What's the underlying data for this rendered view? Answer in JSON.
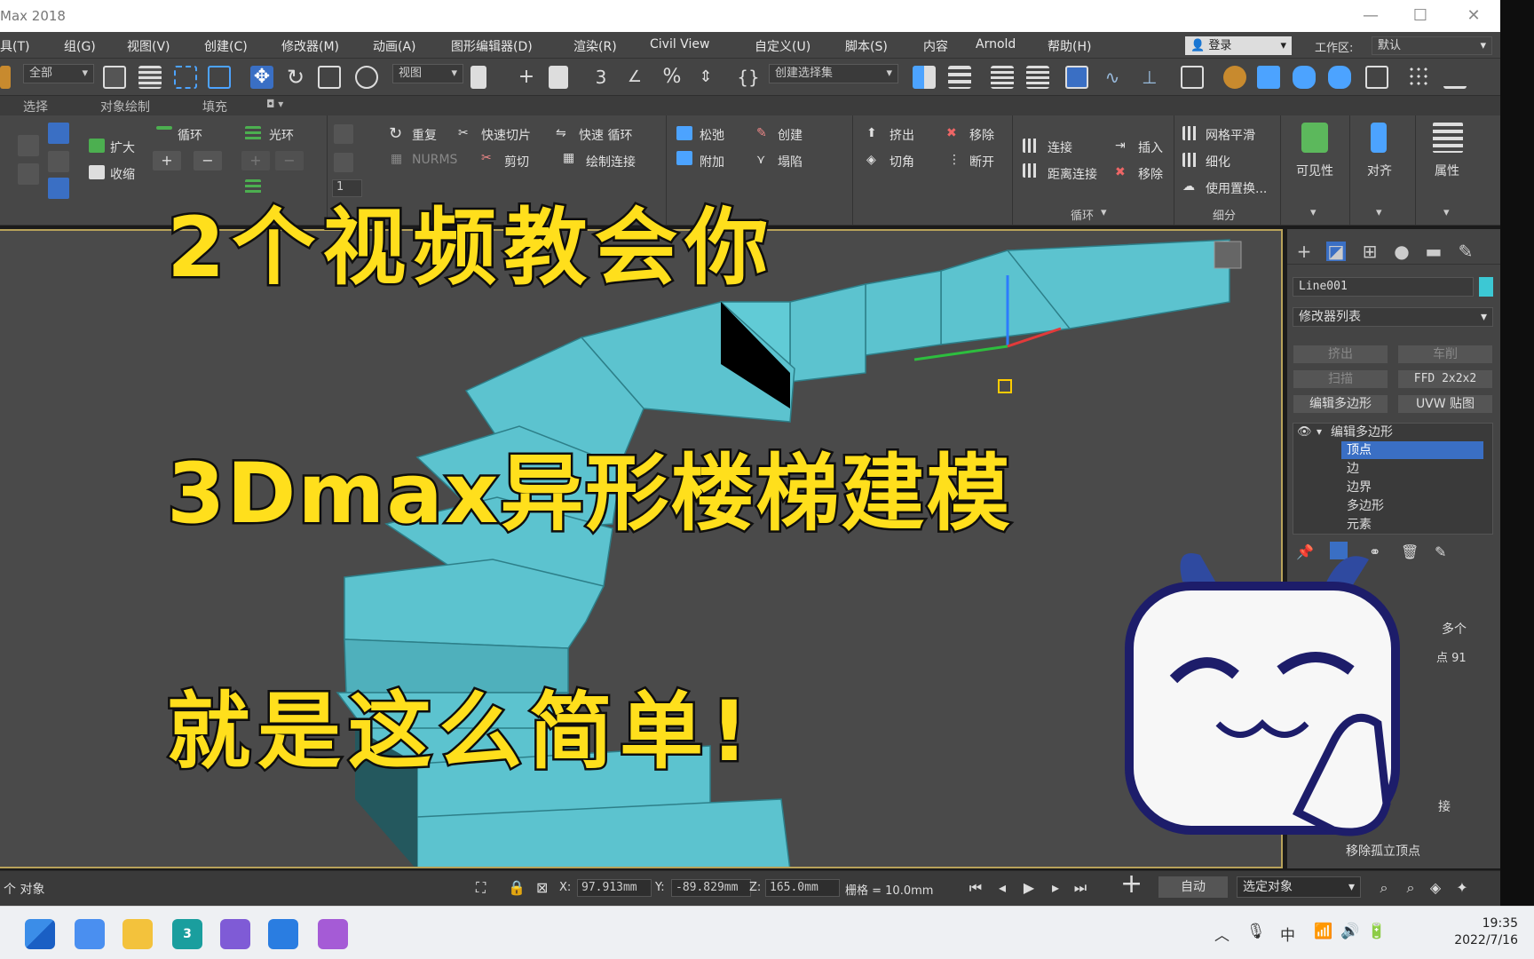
{
  "window": {
    "title": "Max 2018",
    "minimize": "—",
    "maximize": "☐",
    "close": "✕"
  },
  "menu": {
    "items": [
      "具(T)",
      "组(G)",
      "视图(V)",
      "创建(C)",
      "修改器(M)",
      "动画(A)",
      "图形编辑器(D)",
      "渲染(R)",
      "Civil View",
      "自定义(U)",
      "脚本(S)",
      "内容",
      "Arnold",
      "帮助(H)"
    ],
    "login": "登录",
    "workspace_label": "工作区:",
    "workspace_value": "默认"
  },
  "toolbar": {
    "filter": "全部",
    "coord_system": "视图",
    "selection_set": "创建选择集"
  },
  "ribbon_tabs": {
    "select": "选择",
    "object_paint": "对象绘制",
    "fill": "填充"
  },
  "ribbon": {
    "grow": "扩大",
    "shrink": "收缩",
    "loop": "循环",
    "ring": "光环",
    "repeat": "重复",
    "nurms": "NURMS",
    "quickslice": "快速切片",
    "cut": "剪切",
    "swiftloop": "快速 循环",
    "paintconnect": "绘制连接",
    "relax": "松弛",
    "attach": "附加",
    "create": "创建",
    "collapse": "塌陷",
    "extrude": "挤出",
    "chamfer": "切角",
    "remove": "移除",
    "break": "断开",
    "connect": "连接",
    "distconnect": "距离连接",
    "insert": "插入",
    "remove2": "移除",
    "meshsmooth": "网格平滑",
    "tessellate": "细化",
    "usedisplace": "使用置换...",
    "loop_group": "循环",
    "subdiv_group": "细分",
    "visibility": "可见性",
    "align": "对齐",
    "properties": "属性",
    "spinner_val": "1"
  },
  "command_panel": {
    "object_name": "Line001",
    "object_color": "#3cc8d4",
    "modifier_list": "修改器列表",
    "buttons": [
      "挤出",
      "车削",
      "扫描",
      "FFD 2x2x2",
      "编辑多边形",
      "UVW 贴图"
    ],
    "stack_root": "编辑多边形",
    "stack_items": [
      "顶点",
      "边",
      "边界",
      "多边形",
      "元素"
    ],
    "partial_1": "多个",
    "partial_2": "点 91",
    "partial_3": "接",
    "partial_4": "移除孤立顶点"
  },
  "overlay": {
    "line1": "2个视频教会你",
    "line2": "3Dmax异形楼梯建模",
    "line3": "就是这么简单!"
  },
  "status": {
    "selection": "个 对象",
    "x_label": "X:",
    "x_value": "97.913mm",
    "y_label": "Y:",
    "y_value": "-89.829mm",
    "z_label": "Z:",
    "z_value": "165.0mm",
    "grid": "栅格 = 10.0mm",
    "auto": "自动",
    "selected_object": "选定对象"
  },
  "taskbar": {
    "time": "19:35",
    "date": "2022/7/16",
    "ime": "中"
  },
  "colors": {
    "stairs": "#5cc3cf",
    "overlay_text": "#ffdf1c",
    "viewport_border": "#b8a25a"
  }
}
